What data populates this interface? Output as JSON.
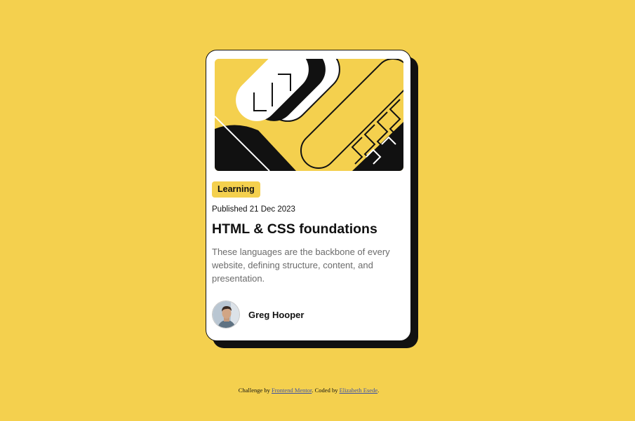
{
  "colors": {
    "background": "#F4D04E",
    "card": "#FFFFFF",
    "ink": "#111111",
    "muted_text": "#6B6B6B",
    "tag_background": "#F4D04E",
    "link": "#3F56A1"
  },
  "card": {
    "illustration_icon": "abstract-geometric-illustration",
    "tag": "Learning",
    "published": "Published 21 Dec 2023",
    "title": "HTML & CSS foundations",
    "description": "These languages are the backbone of every website, defining structure, content, and presentation.",
    "author": {
      "name": "Greg Hooper",
      "avatar_icon": "portrait-avatar"
    }
  },
  "attribution": {
    "prefix": "Challenge by ",
    "challenge_link": "Frontend Mentor",
    "middle": ". Coded by ",
    "author_link": "Elizabeth Esede",
    "suffix": "."
  }
}
